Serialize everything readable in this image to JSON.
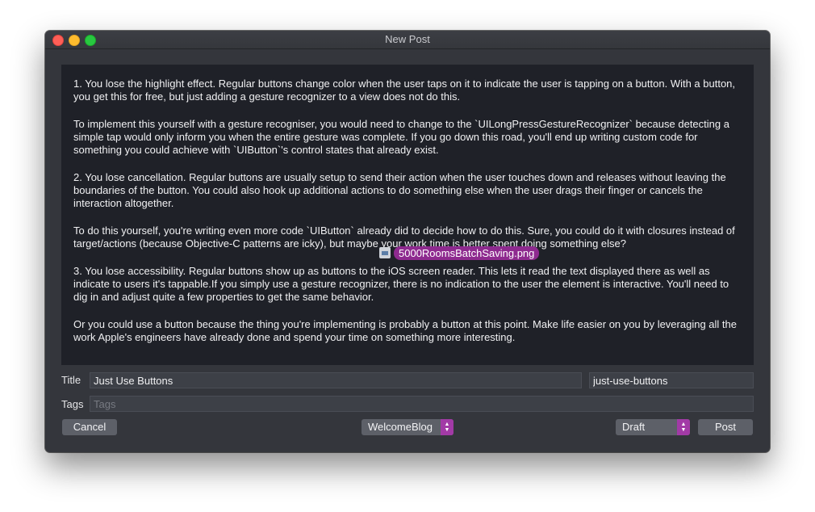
{
  "window": {
    "title": "New Post"
  },
  "editor": {
    "paragraphs": [
      "1. You lose the highlight effect. Regular buttons change color when the user taps on it to indicate the user is tapping on a button. With a button, you get this for free, but just adding a gesture recognizer to a view does not do this.",
      "To implement this yourself with a gesture recogniser, you would need to change to the `UILongPressGestureRecognizer` because detecting a simple tap would only inform you when the entire gesture was complete. If you go down this road, you'll end up writing custom code for something you could achieve with `UIButton`'s control states that already exist.",
      "2. You lose cancellation. Regular buttons are usually setup to send their action when the user touches down and releases without leaving the boundaries of the button. You could also hook up additional actions to do something else when the user drags their finger or cancels the interaction altogether.",
      "To do this yourself, you're writing even more code `UIButton` already did to decide how to do this. Sure, you could do it with closures instead of target/actions (because Objective-C patterns are icky), but maybe your work time is better spent doing something else?",
      "3. You lose accessibility. Regular buttons show up as buttons to the iOS screen reader. This lets it read the text displayed there as well as indicate to users it's tappable.If you simply use a gesture recognizer, there is no indication to the user the element is interactive. You'll need to dig in and adjust quite a few properties to get the same behavior.",
      "Or you could use a button because the thing you're implementing is probably a button at this point. Make life easier on you by leveraging all the work Apple's engineers have already done and spend your time on something more interesting."
    ],
    "dragged_file": "5000RoomsBatchSaving.png"
  },
  "form": {
    "title_label": "Title",
    "title_value": "Just Use Buttons",
    "slug_value": "just-use-buttons",
    "tags_label": "Tags",
    "tags_placeholder": "Tags"
  },
  "footer": {
    "cancel_label": "Cancel",
    "blog_select": "WelcomeBlog",
    "status_select": "Draft",
    "post_label": "Post"
  },
  "colors": {
    "accent": "#a23aa6",
    "window_bg": "#34363c",
    "editor_bg": "#1f2128"
  },
  "icons": [
    "close-icon",
    "minimize-icon",
    "maximize-icon",
    "file-icon",
    "stepper-icon"
  ]
}
